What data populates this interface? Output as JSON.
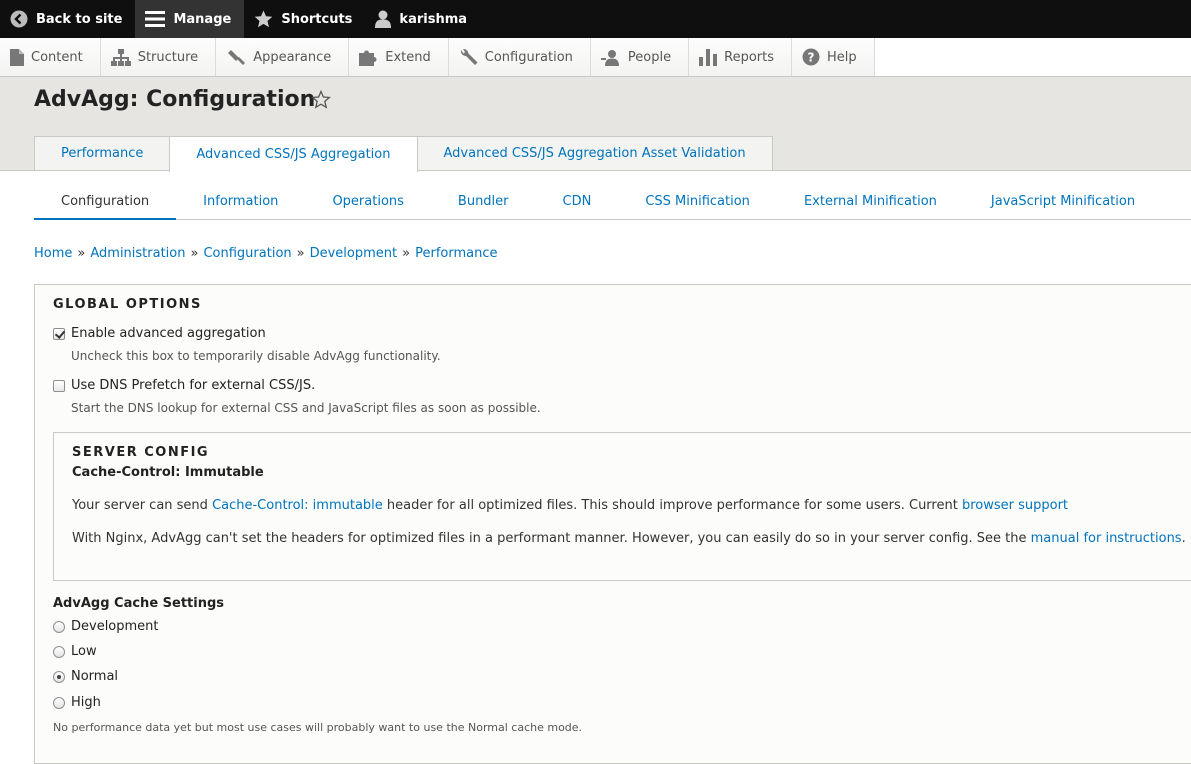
{
  "toolbar": {
    "back_label": "Back to site",
    "manage_label": "Manage",
    "shortcuts_label": "Shortcuts",
    "user_label": "karishma"
  },
  "tray": [
    {
      "label": "Content",
      "icon": "file-icon"
    },
    {
      "label": "Structure",
      "icon": "sitemap-icon"
    },
    {
      "label": "Appearance",
      "icon": "paintbrush-icon"
    },
    {
      "label": "Extend",
      "icon": "puzzle-icon"
    },
    {
      "label": "Configuration",
      "icon": "wrench-icon"
    },
    {
      "label": "People",
      "icon": "person-icon"
    },
    {
      "label": "Reports",
      "icon": "bar-chart-icon"
    },
    {
      "label": "Help",
      "icon": "help-icon"
    }
  ],
  "page": {
    "title": "AdvAgg: Configuration"
  },
  "primary_tabs": [
    {
      "label": "Performance"
    },
    {
      "label": "Advanced CSS/JS Aggregation"
    },
    {
      "label": "Advanced CSS/JS Aggregation Asset Validation"
    }
  ],
  "secondary_tabs": [
    {
      "label": "Configuration"
    },
    {
      "label": "Information"
    },
    {
      "label": "Operations"
    },
    {
      "label": "Bundler"
    },
    {
      "label": "CDN"
    },
    {
      "label": "CSS Minification"
    },
    {
      "label": "External Minification"
    },
    {
      "label": "JavaScript Minification"
    }
  ],
  "breadcrumb": [
    "Home",
    "Administration",
    "Configuration",
    "Development",
    "Performance"
  ],
  "breadcrumb_sep": "»",
  "global_options": {
    "legend": "GLOBAL OPTIONS",
    "enable_label": "Enable advanced aggregation",
    "enable_desc": "Uncheck this box to temporarily disable AdvAgg functionality.",
    "dns_label": "Use DNS Prefetch for external CSS/JS.",
    "dns_desc": "Start the DNS lookup for external CSS and JavaScript files as soon as possible."
  },
  "server_config": {
    "legend": "SERVER CONFIG",
    "subtitle": "Cache-Control: Immutable",
    "p1_before": "Your server can send ",
    "p1_link": "Cache-Control: immutable",
    "p1_after": " header for all optimized files. This should improve performance for some users. Current ",
    "p1_link2": "browser support",
    "p2_before": "With Nginx, AdvAgg can't set the headers for optimized files in a performant manner. However, you can easily do so in your server config. See the ",
    "p2_link": "manual for instructions",
    "p2_after": "."
  },
  "cache_settings": {
    "title": "AdvAgg Cache Settings",
    "options": [
      "Development",
      "Low",
      "Normal",
      "High"
    ],
    "selected": "Normal",
    "note": "No performance data yet but most use cases will probably want to use the Normal cache mode."
  },
  "colors": {
    "link": "#0074bd",
    "toolbar_bg": "#0f0f0f",
    "header_bg": "#e6e5e1"
  }
}
